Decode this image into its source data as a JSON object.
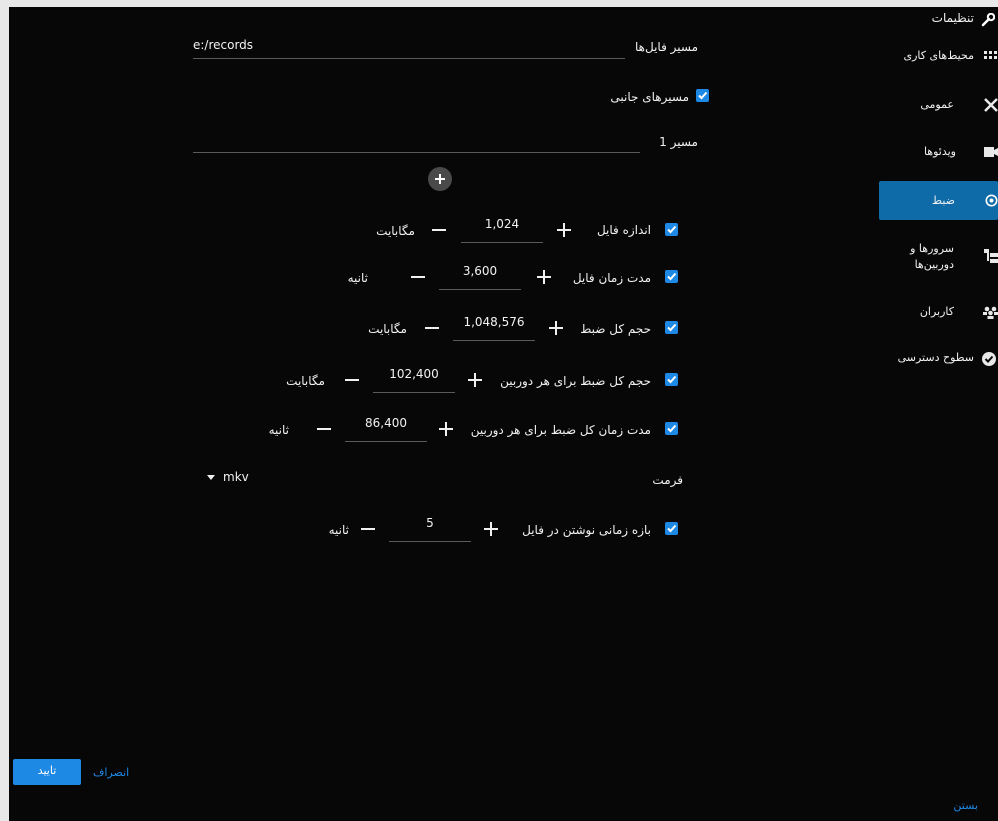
{
  "sidebar": {
    "title": "تنظیمات",
    "items": [
      {
        "label": "محیط‌های کاری",
        "icon": "grid-icon"
      },
      {
        "label": "عمومی",
        "icon": "tools-icon"
      },
      {
        "label": "ویدئوها",
        "icon": "video-icon"
      },
      {
        "label": "ضبط",
        "icon": "record-icon",
        "active": true
      },
      {
        "label": "سرورها و دوربین‌ها",
        "line1": "سرورها و",
        "line2": "دوربین‌ها",
        "icon": "server-icon"
      },
      {
        "label": "کاربران",
        "icon": "users-icon"
      },
      {
        "label": "سطوح دسترسی",
        "icon": "check-circle-icon"
      }
    ],
    "close_label": "بستن",
    "active_color": "#0e6ba8"
  },
  "recording": {
    "file_path_label": "مسیر فایل‌ها",
    "file_path_value": "e:/records",
    "side_paths_label": "مسیرهای جانبی",
    "side_path_1_label": "مسیر 1",
    "side_path_1_value": "",
    "rows": [
      {
        "label": "اندازه فایل",
        "value": "1,024",
        "unit": "مگابایت",
        "checked": true
      },
      {
        "label": "مدت زمان فایل",
        "value": "3,600",
        "unit": "ثانیه",
        "checked": true
      },
      {
        "label": "حجم کل ضبط",
        "value": "1,048,576",
        "unit": "مگابایت",
        "checked": true
      },
      {
        "label": "حجم کل ضبط برای هر دوربین",
        "value": "102,400",
        "unit": "مگابایت",
        "checked": true
      },
      {
        "label": "مدت زمان کل ضبط برای هر دوربین",
        "value": "86,400",
        "unit": "ثانیه",
        "checked": true
      }
    ],
    "format_label": "فرمت",
    "format_value": "mkv",
    "write_interval": {
      "label": "بازه زمانی نوشتن در فایل",
      "value": "5",
      "unit": "ثانیه",
      "checked": true
    }
  },
  "footer": {
    "confirm_label": "تایید",
    "cancel_label": "انصراف",
    "accent_color": "#1e88e5"
  }
}
